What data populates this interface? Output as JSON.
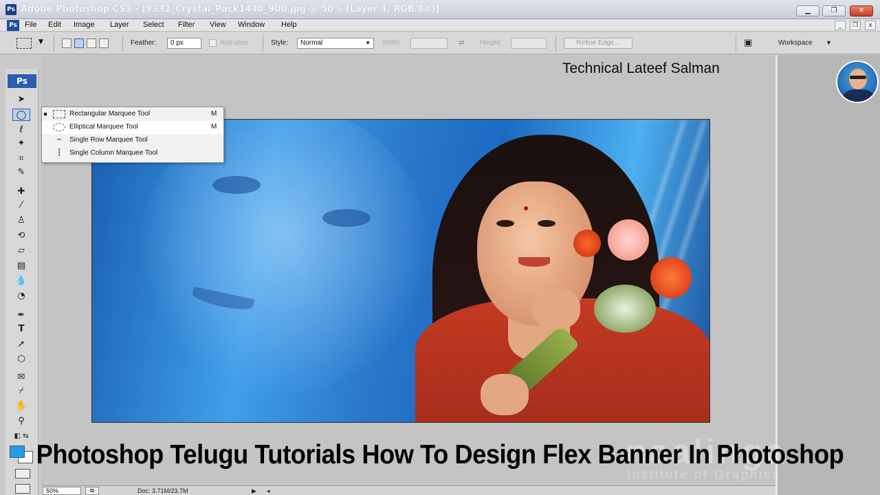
{
  "window": {
    "title": "Adobe Photoshop CS3 - [9332_Crystal_Pack1440_900.jpg @ 50% (Layer 4, RGB/8#)]",
    "ps_badge": "Ps"
  },
  "menubar": {
    "items": [
      "File",
      "Edit",
      "Image",
      "Layer",
      "Select",
      "Filter",
      "View",
      "Window",
      "Help"
    ]
  },
  "options": {
    "feather_label": "Feather:",
    "feather_value": "0 px",
    "antialias_label": "Anti-alias",
    "style_label": "Style:",
    "style_value": "Normal",
    "width_label": "Width:",
    "height_label": "Height:",
    "refine_edge_label": "Refine Edge...",
    "workspace_label": "Workspace"
  },
  "toolbox": {
    "logo": "Ps"
  },
  "marquee_flyout": {
    "items": [
      {
        "label": "Rectangular Marquee Tool",
        "shortcut": "M",
        "icon": "rect-marquee-icon"
      },
      {
        "label": "Elliptical Marquee Tool",
        "shortcut": "M",
        "icon": "ellipse-marquee-icon"
      },
      {
        "label": "Single Row Marquee Tool",
        "shortcut": "",
        "icon": "single-row-icon"
      },
      {
        "label": "Single Column Marquee Tool",
        "shortcut": "",
        "icon": "single-column-icon"
      }
    ]
  },
  "overlay": {
    "channel_name": "Technical Lateef Salman",
    "video_title": "Photoshop Telugu Tutorials How To Design Flex Banner In Photoshop"
  },
  "statusbar": {
    "zoom": "50%",
    "doc_info": "Doc: 3.71M/23.7M"
  },
  "colors": {
    "foreground": "#1e9ee8",
    "background": "#ffffff"
  }
}
